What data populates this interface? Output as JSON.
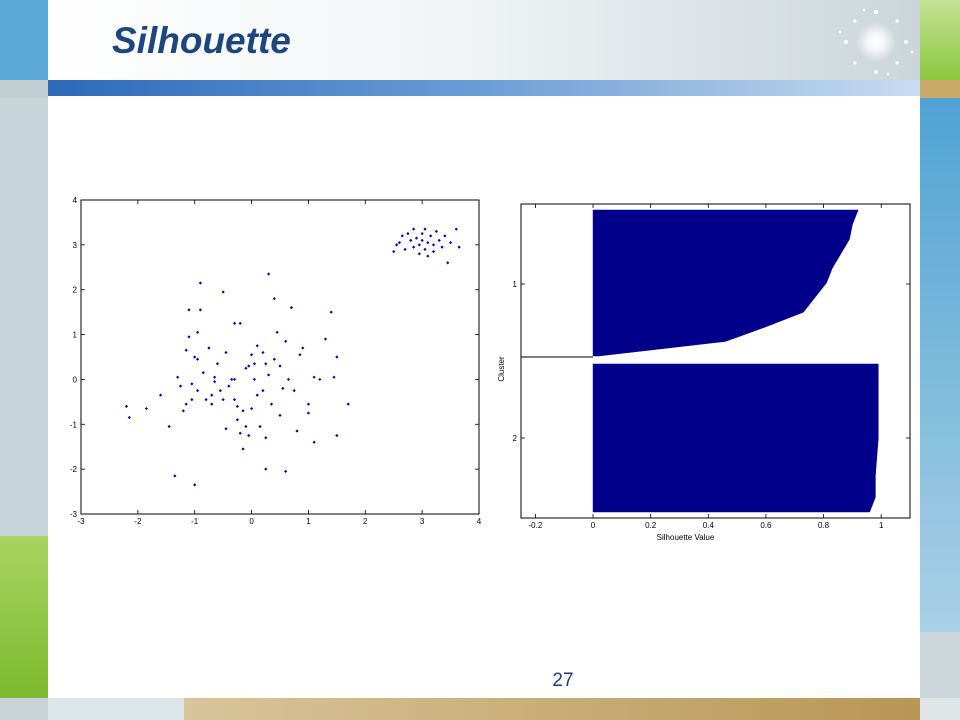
{
  "slide": {
    "title": "Silhouette",
    "page_number": "27"
  },
  "colors": {
    "title": "#1c4680",
    "points": "#0000b8",
    "bars": "#00008b",
    "accent_green": "#8cc63f",
    "accent_blue": "#5aa9d6",
    "accent_tan": "#c8a968"
  },
  "chart_data": [
    {
      "type": "scatter",
      "title": "",
      "xlabel": "",
      "ylabel": "",
      "xlim": [
        -3,
        4
      ],
      "ylim": [
        -3,
        4
      ],
      "x_ticks": [
        "-3",
        "-2",
        "-1",
        "0",
        "1",
        "2",
        "3",
        "4"
      ],
      "y_ticks": [
        "-3",
        "-2",
        "-1",
        "0",
        "1",
        "2",
        "3",
        "4"
      ],
      "series": [
        {
          "points": [
            [
              -2.2,
              -0.6
            ],
            [
              -2.15,
              -0.85
            ],
            [
              -1.85,
              -0.65
            ],
            [
              -1.6,
              -0.35
            ],
            [
              -1.45,
              -1.05
            ],
            [
              -1.35,
              -2.15
            ],
            [
              -1.3,
              0.05
            ],
            [
              -1.25,
              -0.15
            ],
            [
              -1.2,
              -0.7
            ],
            [
              -1.15,
              -0.55
            ],
            [
              -1.15,
              0.65
            ],
            [
              -1.1,
              1.55
            ],
            [
              -1.1,
              0.95
            ],
            [
              -1.05,
              -0.1
            ],
            [
              -1.05,
              -0.45
            ],
            [
              -1.0,
              0.5
            ],
            [
              -1.0,
              -2.35
            ],
            [
              -0.95,
              0.45
            ],
            [
              -0.95,
              -0.25
            ],
            [
              -0.95,
              1.05
            ],
            [
              -0.9,
              2.15
            ],
            [
              -0.9,
              1.55
            ],
            [
              -0.85,
              0.15
            ],
            [
              -0.8,
              -0.45
            ],
            [
              -0.75,
              0.7
            ],
            [
              -0.7,
              -0.35
            ],
            [
              -0.7,
              -0.55
            ],
            [
              -0.65,
              -0.05
            ],
            [
              -0.65,
              0.05
            ],
            [
              -0.6,
              0.35
            ],
            [
              -0.55,
              -0.25
            ],
            [
              -0.5,
              -0.45
            ],
            [
              -0.5,
              1.95
            ],
            [
              -0.45,
              0.6
            ],
            [
              -0.45,
              -1.1
            ],
            [
              -0.4,
              -0.15
            ],
            [
              -0.35,
              0.0
            ],
            [
              -0.3,
              1.25
            ],
            [
              -0.3,
              0.0
            ],
            [
              -0.3,
              -0.45
            ],
            [
              -0.25,
              -0.6
            ],
            [
              -0.25,
              -0.9
            ],
            [
              -0.2,
              -1.2
            ],
            [
              -0.2,
              1.25
            ],
            [
              -0.15,
              -0.7
            ],
            [
              -0.15,
              -1.55
            ],
            [
              -0.1,
              0.25
            ],
            [
              -0.1,
              -1.05
            ],
            [
              -0.05,
              0.3
            ],
            [
              -0.05,
              -1.25
            ],
            [
              0.0,
              0.55
            ],
            [
              0.0,
              -0.65
            ],
            [
              0.05,
              0.35
            ],
            [
              0.05,
              0.0
            ],
            [
              0.1,
              -0.35
            ],
            [
              0.1,
              0.75
            ],
            [
              0.15,
              -1.05
            ],
            [
              0.2,
              0.6
            ],
            [
              0.2,
              -0.25
            ],
            [
              0.25,
              0.35
            ],
            [
              0.25,
              -1.3
            ],
            [
              0.25,
              -2.0
            ],
            [
              0.3,
              2.35
            ],
            [
              0.3,
              0.1
            ],
            [
              0.35,
              -0.55
            ],
            [
              0.4,
              0.45
            ],
            [
              0.4,
              1.8
            ],
            [
              0.45,
              1.05
            ],
            [
              0.5,
              -0.8
            ],
            [
              0.5,
              0.3
            ],
            [
              0.55,
              -0.2
            ],
            [
              0.6,
              -2.05
            ],
            [
              0.6,
              0.85
            ],
            [
              0.65,
              0.0
            ],
            [
              0.7,
              1.6
            ],
            [
              0.75,
              -0.25
            ],
            [
              0.8,
              -1.15
            ],
            [
              0.85,
              0.55
            ],
            [
              0.9,
              0.7
            ],
            [
              1.0,
              -0.75
            ],
            [
              1.0,
              -0.55
            ],
            [
              1.1,
              -1.4
            ],
            [
              1.1,
              0.05
            ],
            [
              1.2,
              0.0
            ],
            [
              1.3,
              0.9
            ],
            [
              1.4,
              1.5
            ],
            [
              1.45,
              0.05
            ],
            [
              1.5,
              0.5
            ],
            [
              1.5,
              -1.25
            ],
            [
              1.7,
              -0.55
            ],
            [
              2.5,
              2.85
            ],
            [
              2.55,
              3.0
            ],
            [
              2.6,
              3.05
            ],
            [
              2.65,
              3.2
            ],
            [
              2.7,
              2.9
            ],
            [
              2.75,
              3.25
            ],
            [
              2.8,
              3.1
            ],
            [
              2.85,
              3.35
            ],
            [
              2.85,
              2.95
            ],
            [
              2.9,
              3.15
            ],
            [
              2.95,
              2.8
            ],
            [
              2.95,
              3.0
            ],
            [
              3.0,
              3.25
            ],
            [
              3.0,
              3.1
            ],
            [
              3.05,
              2.9
            ],
            [
              3.05,
              3.35
            ],
            [
              3.1,
              3.05
            ],
            [
              3.1,
              2.75
            ],
            [
              3.15,
              3.2
            ],
            [
              3.2,
              3.0
            ],
            [
              3.2,
              2.85
            ],
            [
              3.25,
              3.3
            ],
            [
              3.3,
              3.1
            ],
            [
              3.35,
              2.95
            ],
            [
              3.4,
              3.2
            ],
            [
              3.45,
              2.6
            ],
            [
              3.5,
              3.05
            ],
            [
              3.6,
              3.35
            ],
            [
              3.65,
              2.95
            ]
          ]
        }
      ]
    },
    {
      "type": "bar",
      "orientation": "horizontal",
      "title": "",
      "xlabel": "Silhouette Value",
      "ylabel": "Cluster",
      "xlim": [
        -0.25,
        1.1
      ],
      "x_ticks": [
        "-0.2",
        "0",
        "0.2",
        "0.4",
        "0.6",
        "0.8",
        "1"
      ],
      "y_ticks": [
        "1",
        "2"
      ],
      "clusters": [
        {
          "label": "1",
          "silhouette_profile": [
            [
              0,
              0.92
            ],
            [
              0.1,
              0.9
            ],
            [
              0.2,
              0.89
            ],
            [
              0.3,
              0.86
            ],
            [
              0.4,
              0.83
            ],
            [
              0.5,
              0.81
            ],
            [
              0.6,
              0.77
            ],
            [
              0.7,
              0.73
            ],
            [
              0.8,
              0.6
            ],
            [
              0.9,
              0.46
            ],
            [
              1.0,
              0.02
            ]
          ]
        },
        {
          "label": "2",
          "silhouette_profile": [
            [
              0,
              0.99
            ],
            [
              0.25,
              0.99
            ],
            [
              0.5,
              0.99
            ],
            [
              0.75,
              0.98
            ],
            [
              0.9,
              0.98
            ],
            [
              1.0,
              0.96
            ]
          ]
        }
      ]
    }
  ]
}
